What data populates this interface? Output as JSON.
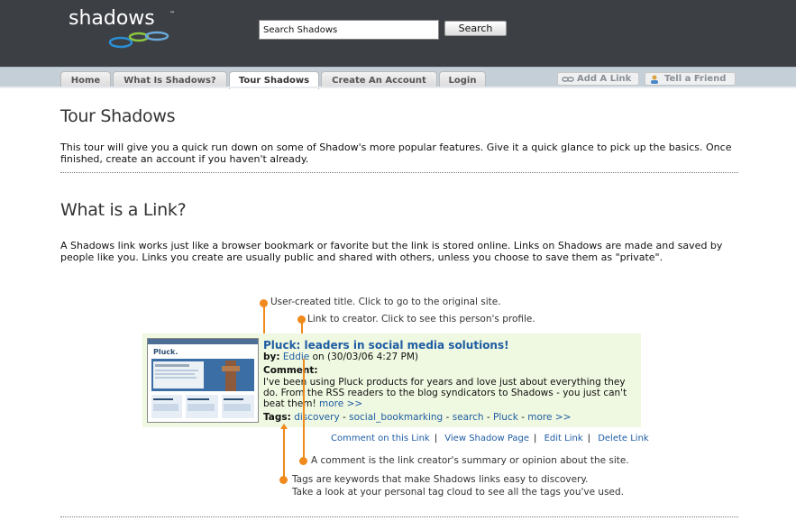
{
  "header": {
    "logo_text": "shadows",
    "logo_tm": "™",
    "search_placeholder": "Search Shadows",
    "search_button": "Search"
  },
  "nav": {
    "tabs": [
      {
        "label": "Home"
      },
      {
        "label": "What Is Shadows?"
      },
      {
        "label": "Tour Shadows"
      },
      {
        "label": "Create An Account"
      },
      {
        "label": "Login"
      }
    ],
    "tools": [
      {
        "label": "Add A Link",
        "icon": "link-chain-icon"
      },
      {
        "label": "Tell a Friend",
        "icon": "person-icon"
      }
    ]
  },
  "main": {
    "title": "Tour Shadows",
    "intro": "This tour will give you a quick run down on some of Shadow's more popular features. Give it a quick glance to pick up the basics. Once finished, create an account if you haven't already.",
    "section_title": "What is a Link?",
    "section_text": "A Shadows link works just like a browser bookmark or favorite but the link is stored online. Links on Shadows are made and saved by people like you. Links you create are usually public and shared with others, unless you choose to save them as \"private\"."
  },
  "callouts": {
    "title_note": "User-created title. Click to go to the original site.",
    "creator_note": "Link to creator. Click to see this person's profile.",
    "comment_note": "A comment is the link creator's summary or opinion about the site.",
    "tags_note_1": "Tags are keywords that make Shadows links easy to discovery.",
    "tags_note_2": "Take a look at your personal tag cloud to see all the tags you've used."
  },
  "example": {
    "title": "Pluck: leaders in social media solutions!",
    "by_label": "by:",
    "creator": "Eddie",
    "date": "on (30/03/06 4:27 PM)",
    "comment_label": "Comment:",
    "comment_text": "I've been using Pluck products for years and love just about everything they do. From the RSS readers to the blog syndicators to Shadows - you just can't beat them!",
    "more_label": "more >>",
    "tags_label": "Tags:",
    "tags": [
      "discovery",
      "social_bookmarking",
      "search",
      "Pluck"
    ],
    "tags_more": "more >>",
    "thumb_brand": "Pluck.",
    "actions": [
      "Comment on this Link",
      "View Shadow Page",
      "Edit Link",
      "Delete Link"
    ]
  },
  "colors": {
    "header_bg": "#3c3f44",
    "nav_bg": "#c5cfd8",
    "accent_orange": "#f08a1c",
    "link_blue": "#1f5da3",
    "example_bg": "#eff8e0"
  }
}
